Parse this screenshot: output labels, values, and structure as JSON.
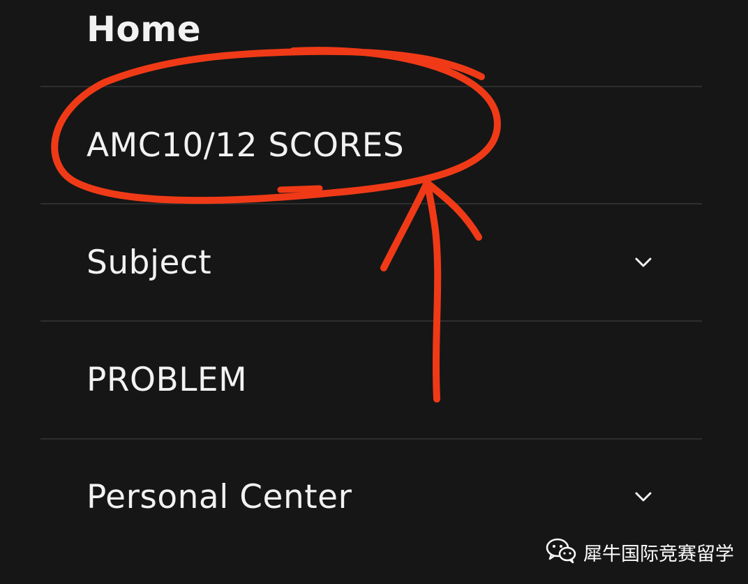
{
  "menu": {
    "items": [
      {
        "label": "Home",
        "has_chevron": false
      },
      {
        "label": "AMC10/12 SCORES",
        "has_chevron": false
      },
      {
        "label": "Subject",
        "has_chevron": true
      },
      {
        "label": "PROBLEM",
        "has_chevron": false
      },
      {
        "label": "Personal Center",
        "has_chevron": true
      }
    ]
  },
  "annotation": {
    "color": "#f03a17",
    "shapes": [
      "circle-around-item",
      "arrow-pointing-up"
    ]
  },
  "watermark": {
    "text": "犀牛国际竞赛留学",
    "icon": "wechat-icon"
  },
  "colors": {
    "background": "#161616",
    "text": "#f2f2f2",
    "divider": "#2e2e2e",
    "annotation": "#f03a17"
  }
}
